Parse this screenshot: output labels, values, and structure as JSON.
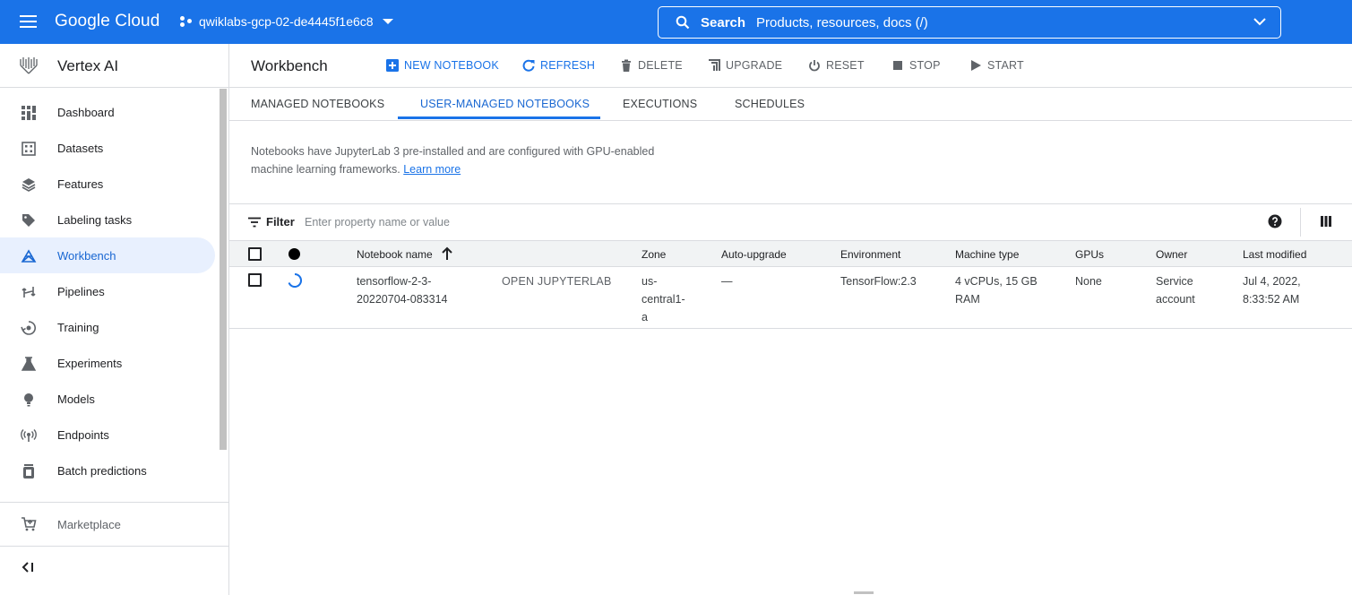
{
  "header": {
    "logo": "Google Cloud",
    "project": "qwiklabs-gcp-02-de4445f1e6c8",
    "search_label": "Search",
    "search_placeholder": "Products, resources, docs (/)",
    "bar_color": "#1a73e8"
  },
  "sidebar": {
    "product": "Vertex AI",
    "items": [
      {
        "label": "Dashboard",
        "icon": "dashboard-icon"
      },
      {
        "label": "Datasets",
        "icon": "datasets-icon"
      },
      {
        "label": "Features",
        "icon": "features-icon"
      },
      {
        "label": "Labeling tasks",
        "icon": "labeling-tag-icon"
      },
      {
        "label": "Workbench",
        "icon": "workbench-icon",
        "active": true
      },
      {
        "label": "Pipelines",
        "icon": "pipelines-icon"
      },
      {
        "label": "Training",
        "icon": "training-icon"
      },
      {
        "label": "Experiments",
        "icon": "experiments-flask-icon"
      },
      {
        "label": "Models",
        "icon": "models-bulb-icon"
      },
      {
        "label": "Endpoints",
        "icon": "endpoints-icon"
      },
      {
        "label": "Batch predictions",
        "icon": "batch-predictions-icon"
      }
    ],
    "marketplace": "Marketplace"
  },
  "toolbar": {
    "title": "Workbench",
    "new_notebook": "NEW NOTEBOOK",
    "refresh": "REFRESH",
    "delete": "DELETE",
    "upgrade": "UPGRADE",
    "reset": "RESET",
    "stop": "STOP",
    "start": "START"
  },
  "tabs": [
    {
      "label": "MANAGED NOTEBOOKS"
    },
    {
      "label": "USER-MANAGED NOTEBOOKS",
      "active": true
    },
    {
      "label": "EXECUTIONS"
    },
    {
      "label": "SCHEDULES"
    }
  ],
  "info": {
    "text_line1": "Notebooks have JupyterLab 3 pre-installed and are configured with GPU-enabled",
    "text_line2": "machine learning frameworks.",
    "learn_more": "Learn more"
  },
  "filter": {
    "label": "Filter",
    "placeholder": "Enter property name or value"
  },
  "table": {
    "columns": {
      "name": "Notebook name",
      "zone": "Zone",
      "auto_upgrade": "Auto-upgrade",
      "environment": "Environment",
      "machine_type": "Machine type",
      "gpus": "GPUs",
      "owner": "Owner",
      "last_modified": "Last modified"
    },
    "rows": [
      {
        "name_line1": "tensorflow-2-3-",
        "name_line2": "20220704-083314",
        "open": "OPEN JUPYTERLAB",
        "zone_line1": "us-",
        "zone_line2": "central1-",
        "zone_line3": "a",
        "auto_upgrade": "—",
        "environment": "TensorFlow:2.3",
        "machine_line1": "4 vCPUs, 15 GB",
        "machine_line2": "RAM",
        "gpus": "None",
        "owner_line1": "Service",
        "owner_line2": "account",
        "modified_line1": "Jul 4, 2022,",
        "modified_line2": "8:33:52 AM"
      }
    ]
  }
}
